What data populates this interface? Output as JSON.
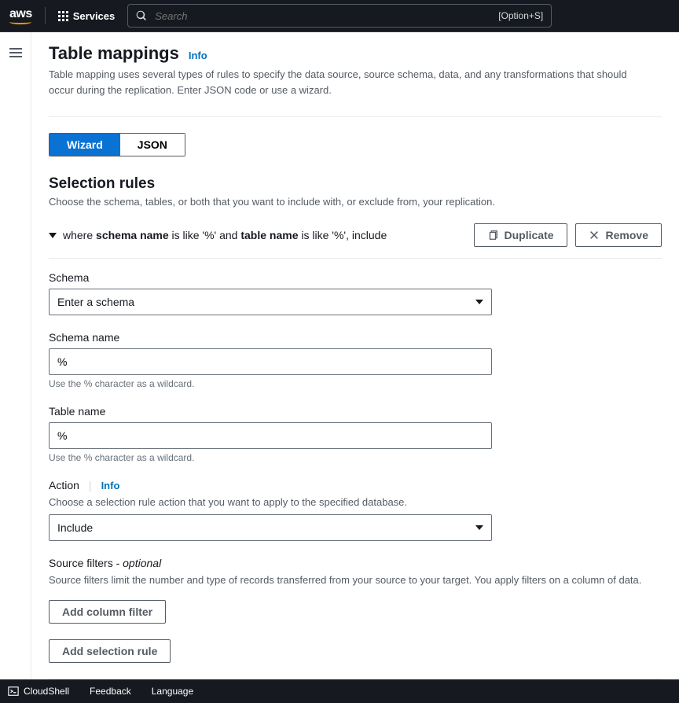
{
  "topbar": {
    "services_label": "Services",
    "search_placeholder": "Search",
    "search_shortcut": "[Option+S]"
  },
  "header": {
    "title": "Table mappings",
    "info": "Info",
    "description": "Table mapping uses several types of rules to specify the data source, source schema, data, and any transformations that should occur during the replication. Enter JSON code or use a wizard."
  },
  "tabs": {
    "wizard": "Wizard",
    "json": "JSON"
  },
  "selection": {
    "title": "Selection rules",
    "description": "Choose the schema, tables, or both that you want to include with, or exclude from, your replication.",
    "rule": {
      "prefix": "where ",
      "schema_bold": "schema name",
      "mid": " is like '%' and ",
      "table_bold": "table name",
      "suffix": " is like '%', include"
    },
    "duplicate": "Duplicate",
    "remove": "Remove"
  },
  "fields": {
    "schema": {
      "label": "Schema",
      "value": "Enter a schema"
    },
    "schema_name": {
      "label": "Schema name",
      "value": "%",
      "hint": "Use the % character as a wildcard."
    },
    "table_name": {
      "label": "Table name",
      "value": "%",
      "hint": "Use the % character as a wildcard."
    },
    "action": {
      "label": "Action",
      "info": "Info",
      "description": "Choose a selection rule action that you want to apply to the specified database.",
      "value": "Include"
    },
    "source_filters": {
      "label": "Source filters - ",
      "optional": "optional",
      "description": "Source filters limit the number and type of records transferred from your source to your target. You apply filters on a column of data."
    },
    "add_column_filter": "Add column filter",
    "add_selection_rule": "Add selection rule"
  },
  "footer": {
    "cloudshell": "CloudShell",
    "feedback": "Feedback",
    "language": "Language"
  }
}
